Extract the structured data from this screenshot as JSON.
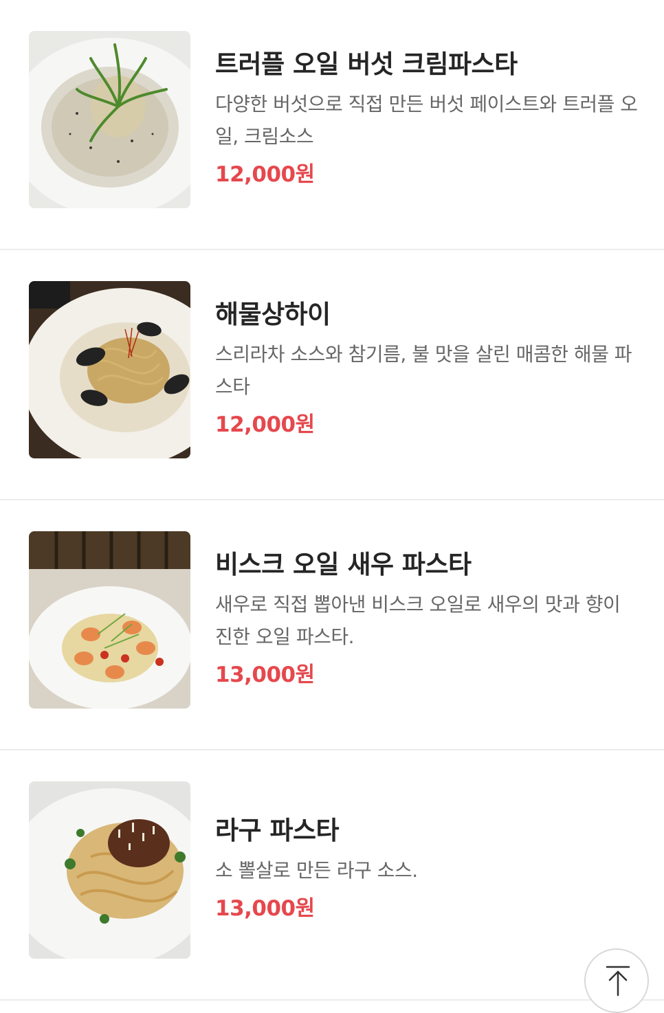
{
  "menu": {
    "items": [
      {
        "name": "트러플 오일 버섯 크림파스타",
        "description": "다양한 버섯으로 직접 만든 버섯 페이스트와 트러플 오일, 크림소스",
        "price": "12,000원",
        "image_icon": "truffle-cream-pasta-photo"
      },
      {
        "name": "해물상하이",
        "description": "스리라차 소스와 참기름, 불 맛을 살린 매콤한 해물 파스타",
        "price": "12,000원",
        "image_icon": "seafood-shanghai-pasta-photo"
      },
      {
        "name": "비스크 오일 새우 파스타",
        "description": "새우로 직접 뽑아낸 비스크 오일로 새우의 맛과 향이 진한 오일 파스타.",
        "price": "13,000원",
        "image_icon": "bisque-shrimp-pasta-photo"
      },
      {
        "name": "라구 파스타",
        "description": "소 뽈살로 만든 라구 소스.",
        "price": "13,000원",
        "image_icon": "ragu-pasta-photo"
      }
    ]
  },
  "scroll_top": {
    "icon": "arrow-up-to-top-icon"
  },
  "colors": {
    "price": "#e5484d",
    "name": "#252525",
    "description": "#666666",
    "divider": "#ececec"
  }
}
